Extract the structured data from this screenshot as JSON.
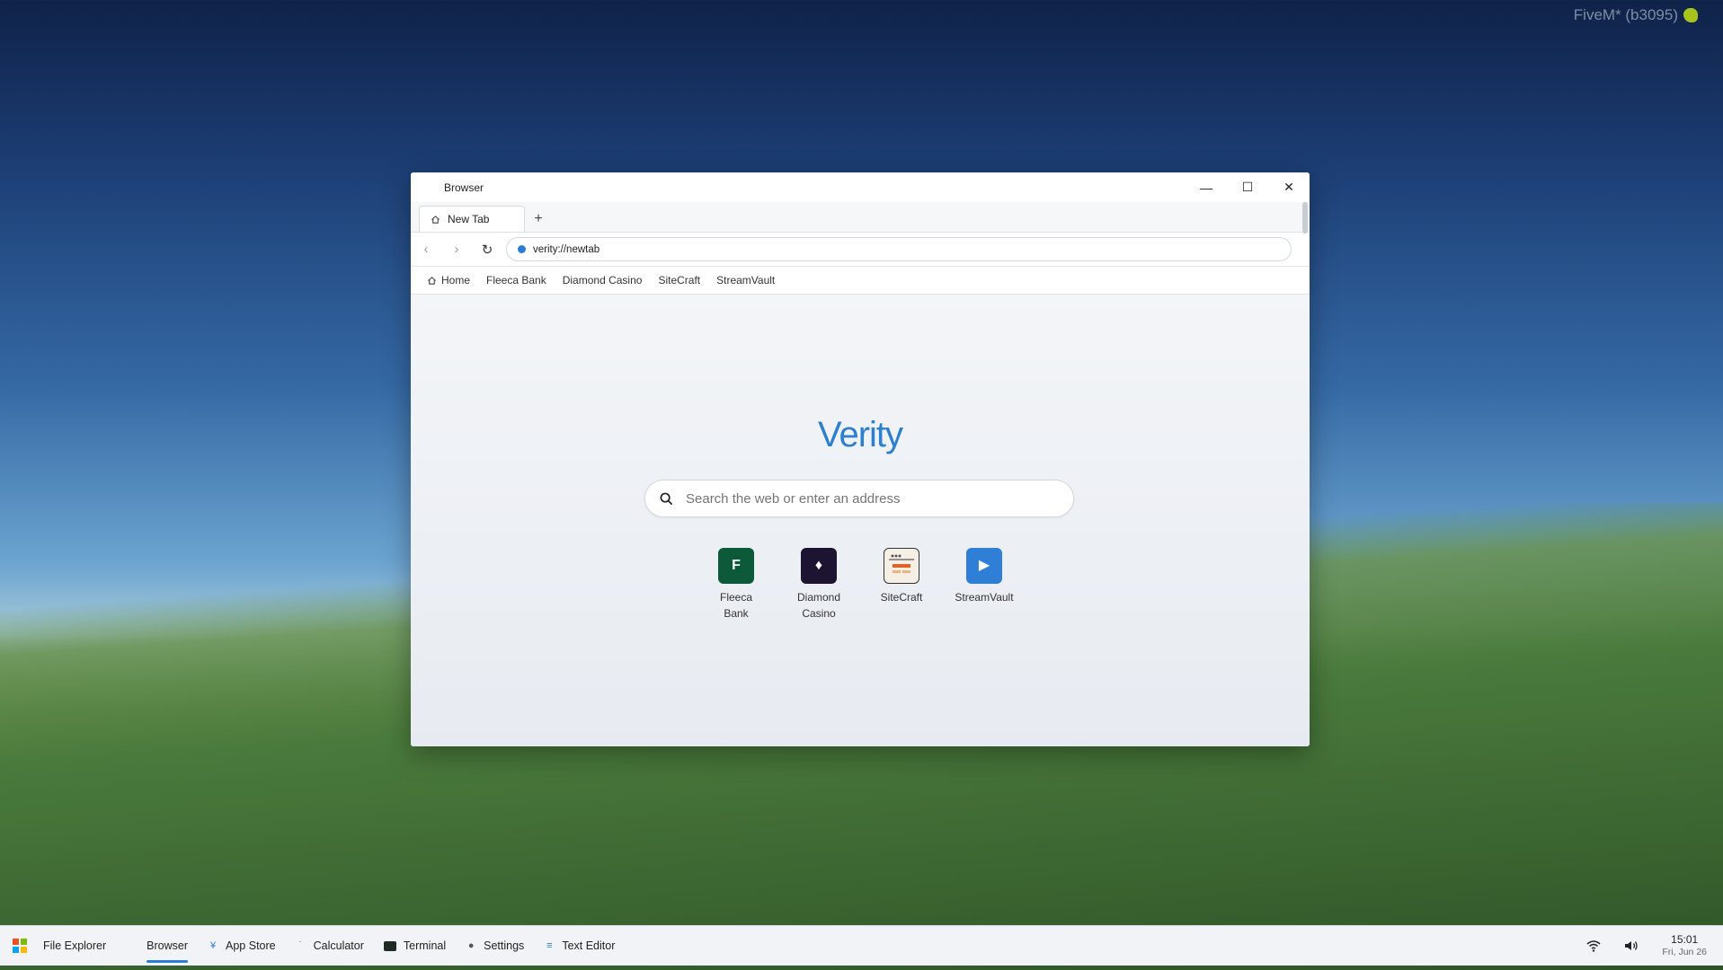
{
  "watermark": {
    "text": "FiveM* (b3095)"
  },
  "window": {
    "title": "Browser",
    "controls": {
      "minimize": "—",
      "maximize": "☐",
      "close": "✕"
    }
  },
  "tabs": [
    {
      "label": "New Tab"
    }
  ],
  "new_tab_symbol": "+",
  "nav": {
    "back": "‹",
    "forward": "›",
    "reload": "↻"
  },
  "address": {
    "value": "verity://newtab"
  },
  "bookmarks": [
    {
      "label": "Home"
    },
    {
      "label": "Fleeca Bank"
    },
    {
      "label": "Diamond Casino"
    },
    {
      "label": "SiteCraft"
    },
    {
      "label": "StreamVault"
    }
  ],
  "newtab": {
    "logo": "Verity",
    "search_placeholder": "Search the web or enter an address",
    "shortcuts": [
      {
        "label_line1": "Fleeca",
        "label_line2": "Bank",
        "glyph": "F",
        "color": "#0c5a3a"
      },
      {
        "label_line1": "Diamond",
        "label_line2": "Casino",
        "glyph": "♦",
        "color": "#1c1430"
      },
      {
        "label_line1": "SiteCraft",
        "label_line2": "",
        "glyph": "",
        "color": "#f5efe6"
      },
      {
        "label_line1": "StreamVault",
        "label_line2": "",
        "glyph": "▶",
        "color": "#2f7fd6"
      }
    ]
  },
  "taskbar": {
    "items": [
      {
        "label": "File Explorer",
        "icon": "folder-icon"
      },
      {
        "label": "Browser",
        "icon": "browser-icon",
        "active": true
      },
      {
        "label": "App Store",
        "icon": "store-icon"
      },
      {
        "label": "Calculator",
        "icon": "calculator-icon"
      },
      {
        "label": "Terminal",
        "icon": "terminal-icon"
      },
      {
        "label": "Settings",
        "icon": "gear-icon"
      },
      {
        "label": "Text Editor",
        "icon": "text-editor-icon"
      }
    ],
    "clock": {
      "time": "15:01",
      "date": "Fri, Jun 26"
    }
  },
  "colors": {
    "accent": "#2a7fd4",
    "logo": "#2d7fd0"
  }
}
